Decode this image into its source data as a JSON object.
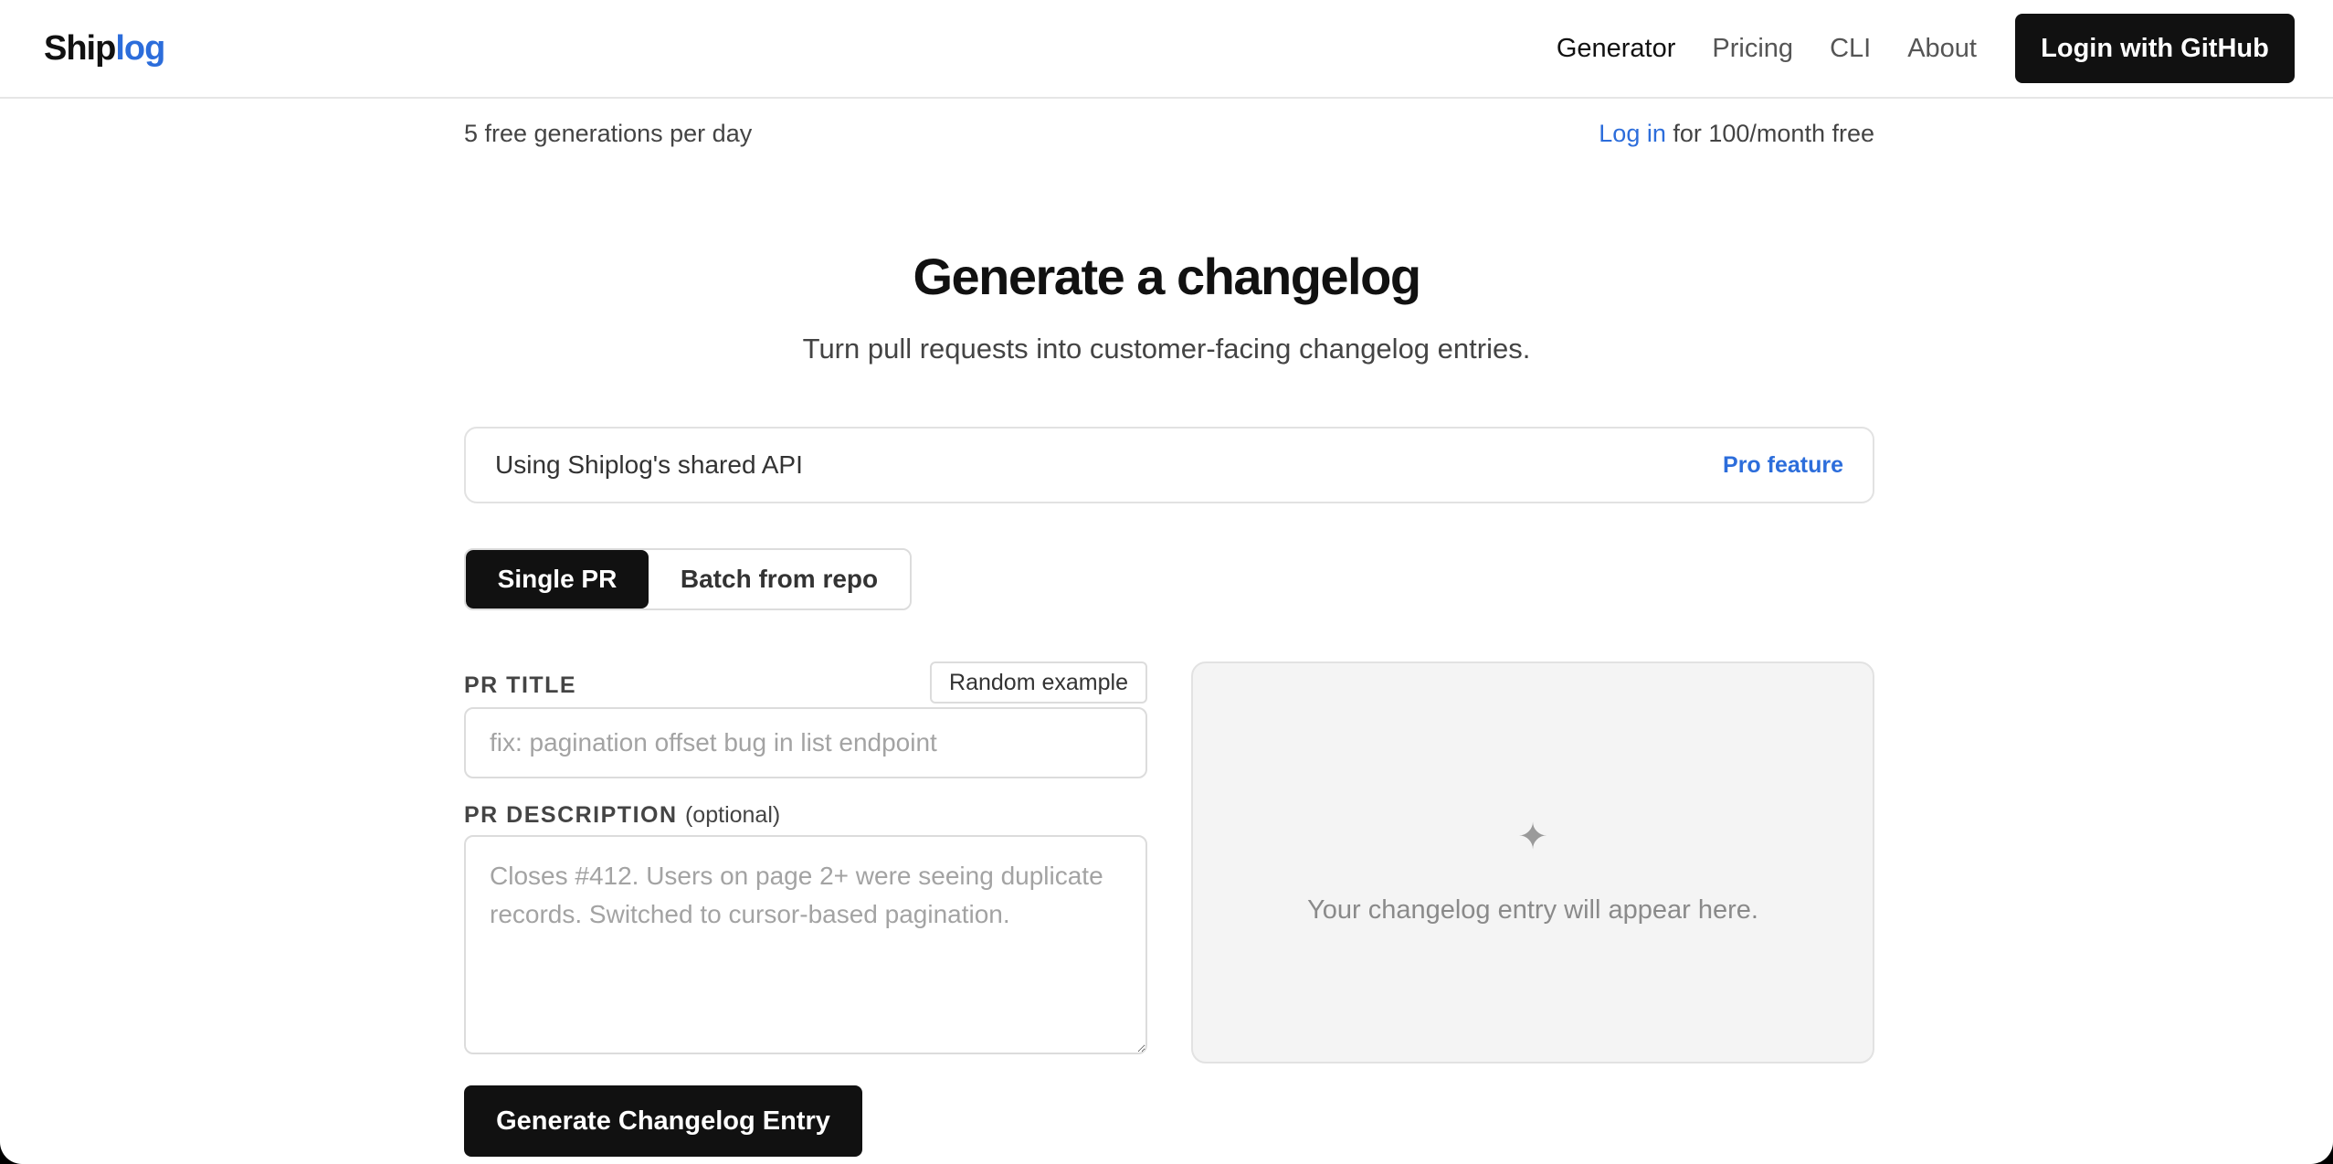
{
  "header": {
    "logo_part1": "Ship",
    "logo_part2": "log",
    "nav": [
      {
        "label": "Generator"
      },
      {
        "label": "Pricing"
      },
      {
        "label": "CLI"
      },
      {
        "label": "About"
      }
    ],
    "login_label": "Login with GitHub"
  },
  "quota": {
    "left": "5 free generations per day",
    "login_link": "Log in",
    "right_suffix": " for 100/month free"
  },
  "hero": {
    "title": "Generate a changelog",
    "subtitle": "Turn pull requests into customer-facing changelog entries."
  },
  "api_bar": {
    "label": "Using Shiplog's shared API",
    "pro_label": "Pro feature"
  },
  "mode_tabs": [
    {
      "label": "Single PR",
      "selected": true
    },
    {
      "label": "Batch from repo",
      "selected": false
    }
  ],
  "form": {
    "pr_title_label": "PR TITLE",
    "random_example_label": "Random example",
    "pr_title_placeholder": "fix: pagination offset bug in list endpoint",
    "pr_title_value": "",
    "pr_desc_label": "PR DESCRIPTION",
    "pr_desc_optional": "(optional)",
    "pr_desc_placeholder": "Closes #412. Users on page 2+ were seeing duplicate records. Switched to cursor-based pagination.",
    "pr_desc_value": "",
    "generate_label": "Generate Changelog Entry"
  },
  "output": {
    "icon": "sparkle-icon",
    "message": "Your changelog entry will appear here."
  },
  "colors": {
    "accent": "#2c6ddb",
    "primary_button": "#111111",
    "output_bg": "#f4f4f4"
  }
}
